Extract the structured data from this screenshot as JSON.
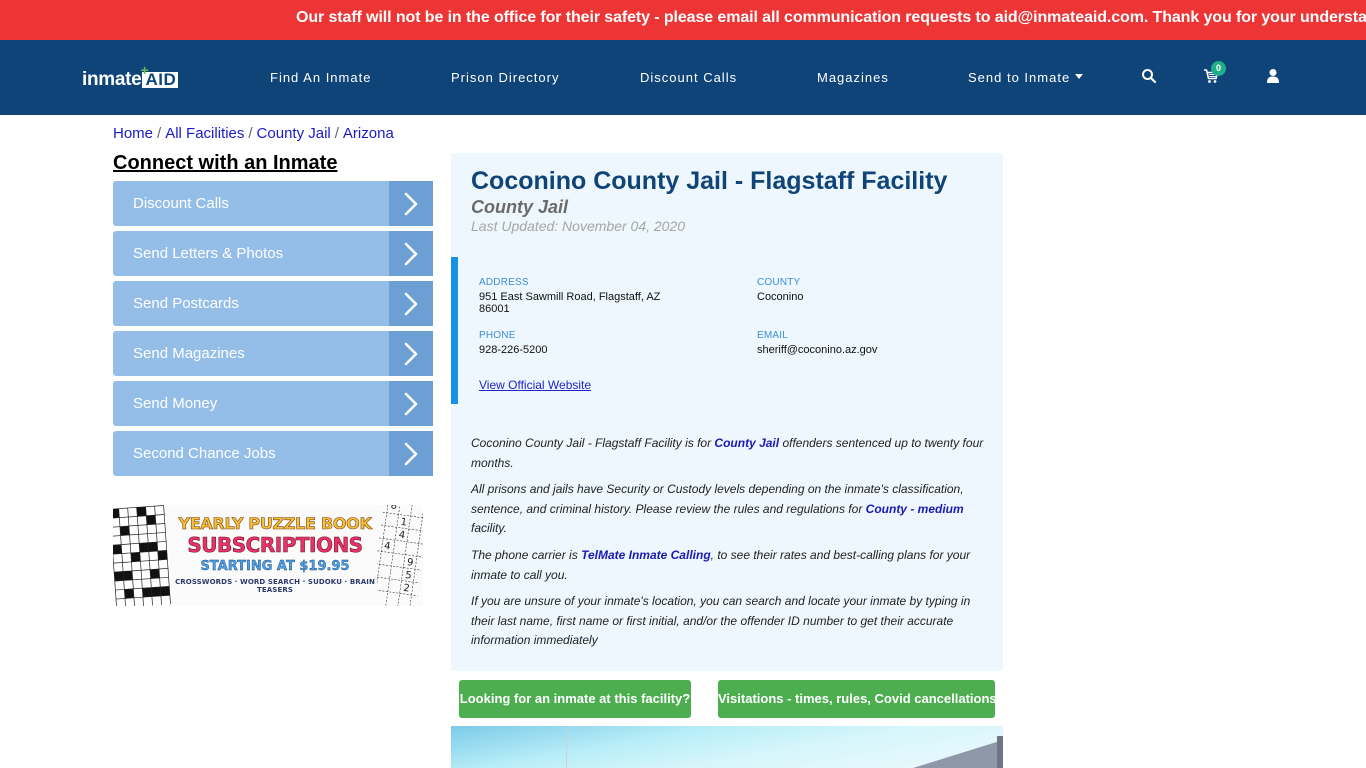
{
  "alert": {
    "text": "Our staff will not be in the office for their safety - please email all communication requests to aid@inmateaid.com. Thank you for your understanding."
  },
  "navbar": {
    "logo": {
      "part1": "inmate",
      "part2": "AID",
      "plus": "+"
    },
    "items": [
      {
        "label": "Find An Inmate"
      },
      {
        "label": "Prison Directory"
      },
      {
        "label": "Discount Calls"
      },
      {
        "label": "Magazines"
      },
      {
        "label": "Send to Inmate",
        "has_dropdown": true
      }
    ],
    "icons": {
      "search": "search-icon",
      "cart": "cart-icon",
      "user": "user-icon"
    },
    "cart_count": "0"
  },
  "breadcrumb": [
    {
      "label": "Home"
    },
    {
      "label": "All Facilities"
    },
    {
      "label": "County Jail"
    },
    {
      "label": "Arizona"
    }
  ],
  "breadcrumb_separator": "/",
  "sidebar": {
    "heading": "Connect with an Inmate",
    "items": [
      {
        "label": "Discount Calls"
      },
      {
        "label": "Send Letters & Photos"
      },
      {
        "label": "Send Postcards"
      },
      {
        "label": "Send Magazines"
      },
      {
        "label": "Send Money"
      },
      {
        "label": "Second Chance Jobs"
      }
    ],
    "ad": {
      "line1": "YEARLY PUZZLE BOOK",
      "line2": "SUBSCRIPTIONS",
      "line3": "STARTING AT $19.95",
      "line4": "CROSSWORDS · WORD SEARCH · SUDOKU · BRAIN TEASERS",
      "sudoku_digits": [
        "8",
        "1",
        "4",
        "4",
        "9",
        "5",
        "2"
      ]
    }
  },
  "facility": {
    "title": "Coconino County Jail - Flagstaff Facility",
    "type": "County Jail",
    "last_updated": "Last Updated: November 04, 2020",
    "info": {
      "address_label": "ADDRESS",
      "address_line1": "951 East Sawmill Road, Flagstaff, AZ",
      "address_line2": "86001",
      "county_label": "COUNTY",
      "county": "Coconino",
      "phone_label": "PHONE",
      "phone": "928-226-5200",
      "email_label": "EMAIL",
      "email": "sheriff@coconino.az.gov",
      "website_link": "View Official Website"
    },
    "description": {
      "p1_before": "Coconino County Jail - Flagstaff Facility is for ",
      "p1_link": "County Jail",
      "p1_after": " offenders sentenced up to twenty four months.",
      "p2_before": "All prisons and jails have Security or Custody levels depending on the inmate's classification, sentence, and criminal history. Please review the rules and regulations for ",
      "p2_link": "County - medium",
      "p2_after": " facility.",
      "p3_before": "The phone carrier is ",
      "p3_link": "TelMate Inmate Calling",
      "p3_after": ", to see their rates and best-calling plans for your inmate to call you.",
      "p4": "If you are unsure of your inmate's location, you can search and locate your inmate by typing in their last name, first name or first initial, and/or the offender ID number to get their accurate information immediately"
    },
    "buttons": {
      "find_inmate": "Looking for an inmate at this facility?",
      "visitations": "Visitations - times, rules, Covid cancellations"
    }
  },
  "colors": {
    "alert_bg": "#ee3535",
    "navbar_bg": "#0f4478",
    "sidebar_item": "#94bde8",
    "sidebar_arrow": "#6c9fd3",
    "panel_bg": "#edf7fd",
    "accent_blue": "#1a8fe8",
    "green_button": "#4cae4f",
    "badge": "#1fae87"
  }
}
